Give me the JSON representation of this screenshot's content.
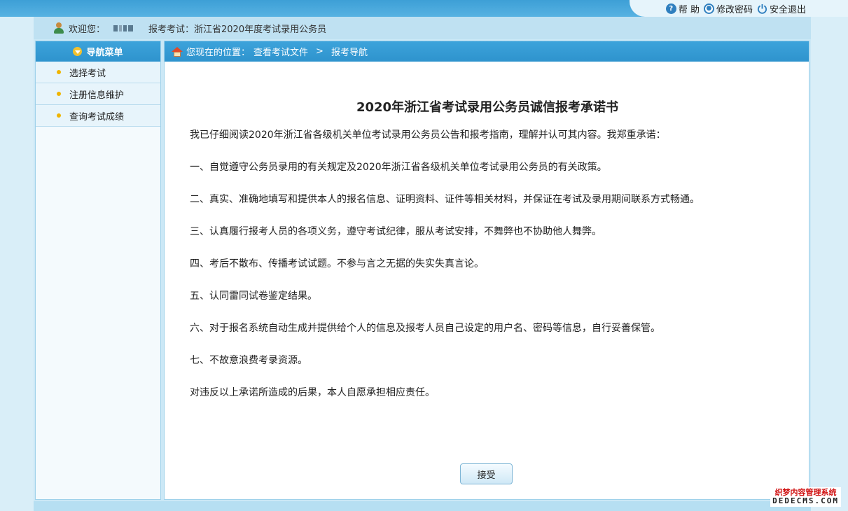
{
  "topbar": {
    "help_label": "帮 助",
    "change_password_label": "修改密码",
    "logout_label": "安全退出"
  },
  "welcome": {
    "greeting": "欢迎您：",
    "exam_label": "报考考试：浙江省2020年度考试录用公务员"
  },
  "sidebar": {
    "title": "导航菜单",
    "items": [
      {
        "label": "选择考试"
      },
      {
        "label": "注册信息维护"
      },
      {
        "label": "查询考试成绩"
      }
    ]
  },
  "breadcrumb": {
    "prefix": "您现在的位置：",
    "path": [
      "查看考试文件",
      "报考导航"
    ],
    "separator": ">"
  },
  "document": {
    "title": "2020年浙江省考试录用公务员诚信报考承诺书",
    "intro": "我已仔细阅读2020年浙江省各级机关单位考试录用公务员公告和报考指南，理解并认可其内容。我郑重承诺：",
    "items": [
      "一、自觉遵守公务员录用的有关规定及2020年浙江省各级机关单位考试录用公务员的有关政策。",
      "二、真实、准确地填写和提供本人的报名信息、证明资料、证件等相关材料，并保证在考试及录用期间联系方式畅通。",
      "三、认真履行报考人员的各项义务，遵守考试纪律，服从考试安排，不舞弊也不协助他人舞弊。",
      "四、考后不散布、传播考试试题。不参与言之无据的失实失真言论。",
      "五、认同雷同试卷鉴定结果。",
      "六、对于报名系统自动生成并提供给个人的信息及报考人员自己设定的用户名、密码等信息，自行妥善保管。",
      "七、不故意浪费考录资源。"
    ],
    "closing": "对违反以上承诺所造成的后果，本人自愿承担相应责任。"
  },
  "accept_button_label": "接受",
  "watermark": {
    "line1": "织梦内容管理系统",
    "line2": "DEDECMS.COM"
  },
  "colors": {
    "header_blue": "#3da3db",
    "page_bg": "#d9eef8",
    "bullet": "#f0b400"
  }
}
